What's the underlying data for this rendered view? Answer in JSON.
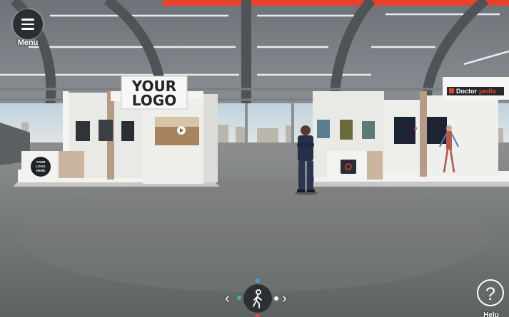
{
  "hud": {
    "menu_label": "Menu",
    "help_label": "Help",
    "help_symbol": "?",
    "nav_left_symbol": "‹",
    "nav_right_symbol": "›"
  },
  "booths": {
    "left": {
      "sign_line1": "YOUR",
      "sign_line2": "LOGO",
      "counter_logo_line1": "YOUR",
      "counter_logo_line2": "LOGO",
      "counter_logo_line3": "HERE"
    },
    "right": {
      "brand_part1": "Doctor",
      "brand_part2": "pedia"
    }
  },
  "colors": {
    "accent_red": "#e8412c",
    "ui_dark": "#2a2d31",
    "dot_green": "#2ecc71",
    "dot_blue": "#3aa6e0",
    "dot_red": "#e04848"
  },
  "icons": {
    "menu": "hamburger-icon",
    "help": "question-mark-icon",
    "walk": "walking-person-icon"
  }
}
